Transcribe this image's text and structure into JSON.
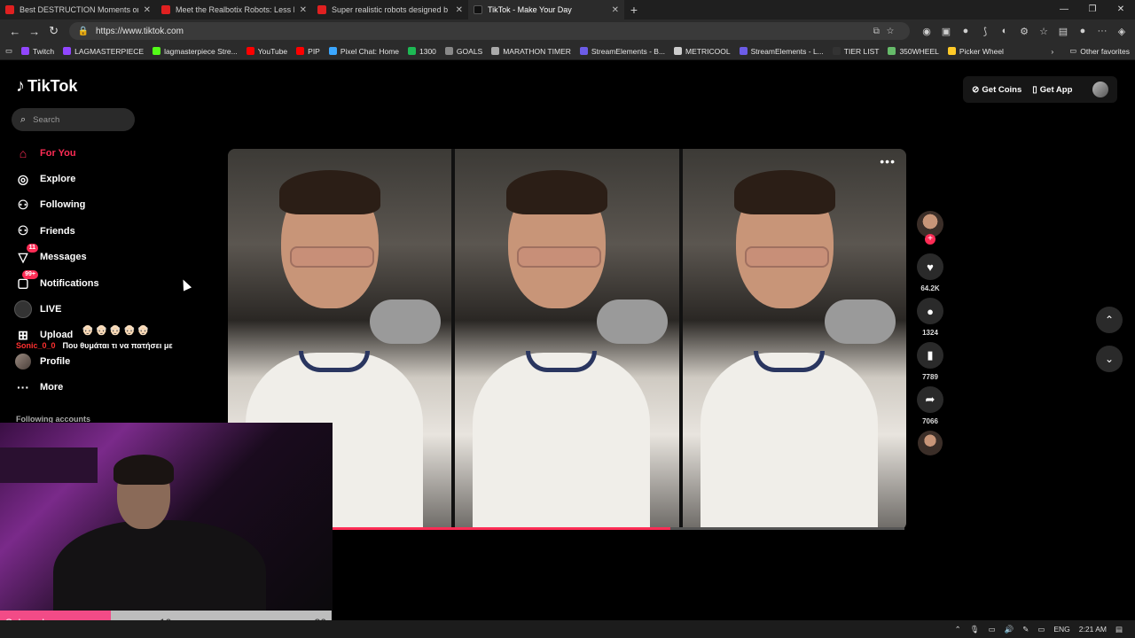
{
  "browser": {
    "tabs": [
      {
        "title": "Best DESTRUCTION Moments on",
        "active": false
      },
      {
        "title": "Meet the Realbotix Robots: Less F",
        "active": false
      },
      {
        "title": "Super realistic robots designed b",
        "active": false
      },
      {
        "title": "TikTok - Make Your Day",
        "active": true
      }
    ],
    "url": "https://www.tiktok.com",
    "bookmarks": [
      {
        "label": "Twitch",
        "color": "#9146ff"
      },
      {
        "label": "LAGMASTERPIECE",
        "color": "#9146ff"
      },
      {
        "label": "lagmasterpiece Stre...",
        "color": "#53fc18"
      },
      {
        "label": "YouTube",
        "color": "#ff0000"
      },
      {
        "label": "PIP",
        "color": "#ff0000"
      },
      {
        "label": "Pixel Chat: Home",
        "color": "#3ba7ff"
      },
      {
        "label": "1300",
        "color": "#1db954"
      },
      {
        "label": "GOALS",
        "color": "#888888"
      },
      {
        "label": "MARATHON TIMER",
        "color": "#aaaaaa"
      },
      {
        "label": "StreamElements - B...",
        "color": "#6c5ce7"
      },
      {
        "label": "METRICOOL",
        "color": "#cccccc"
      },
      {
        "label": "StreamElements - L...",
        "color": "#6c5ce7"
      },
      {
        "label": "TIER LIST",
        "color": "#333333"
      },
      {
        "label": "350WHEEL",
        "color": "#66bb6a"
      },
      {
        "label": "Picker Wheel",
        "color": "#ffca28"
      }
    ],
    "other_favorites": "Other favorites"
  },
  "tiktok": {
    "logo": "TikTok",
    "search_placeholder": "Search",
    "menu": [
      {
        "label": "For You",
        "icon": "home-icon",
        "glyph": "⌂",
        "active": true
      },
      {
        "label": "Explore",
        "icon": "compass-icon",
        "glyph": "◎",
        "active": false
      },
      {
        "label": "Following",
        "icon": "following-icon",
        "glyph": "⚇",
        "active": false
      },
      {
        "label": "Friends",
        "icon": "friends-icon",
        "glyph": "⚇",
        "active": false
      },
      {
        "label": "Messages",
        "icon": "messages-icon",
        "glyph": "▽",
        "badge": "11",
        "active": false
      },
      {
        "label": "Notifications",
        "icon": "notifications-icon",
        "glyph": "▢",
        "badge": "99+",
        "active": false
      },
      {
        "label": "LIVE",
        "icon": "live-icon",
        "glyph": "",
        "active": false
      },
      {
        "label": "Upload",
        "icon": "upload-icon",
        "glyph": "⊞",
        "active": false
      },
      {
        "label": "Profile",
        "icon": "profile-avatar",
        "glyph": "",
        "active": false
      },
      {
        "label": "More",
        "icon": "more-icon",
        "glyph": "···",
        "active": false
      }
    ],
    "following_accounts": "Following accounts",
    "get_coins": "Get Coins",
    "get_app": "Get App",
    "video": {
      "progress": 0.59,
      "likes": "64.2K",
      "comments": "1324",
      "saves": "7789",
      "shares": "7066"
    }
  },
  "overlay": {
    "chat_faces": "👴🏻👴🏻👴🏻👴🏻👴🏻",
    "chat_user": "Sonic_0_0",
    "chat_message": "Που θυμάται τι να πατήσει με",
    "subgoal_label": "Subgoal",
    "subgoal_current": "10",
    "subgoal_max": "30",
    "subgoal_fraction": 0.333
  },
  "taskbar": {
    "lang": "ENG",
    "time": "2:21 AM"
  }
}
